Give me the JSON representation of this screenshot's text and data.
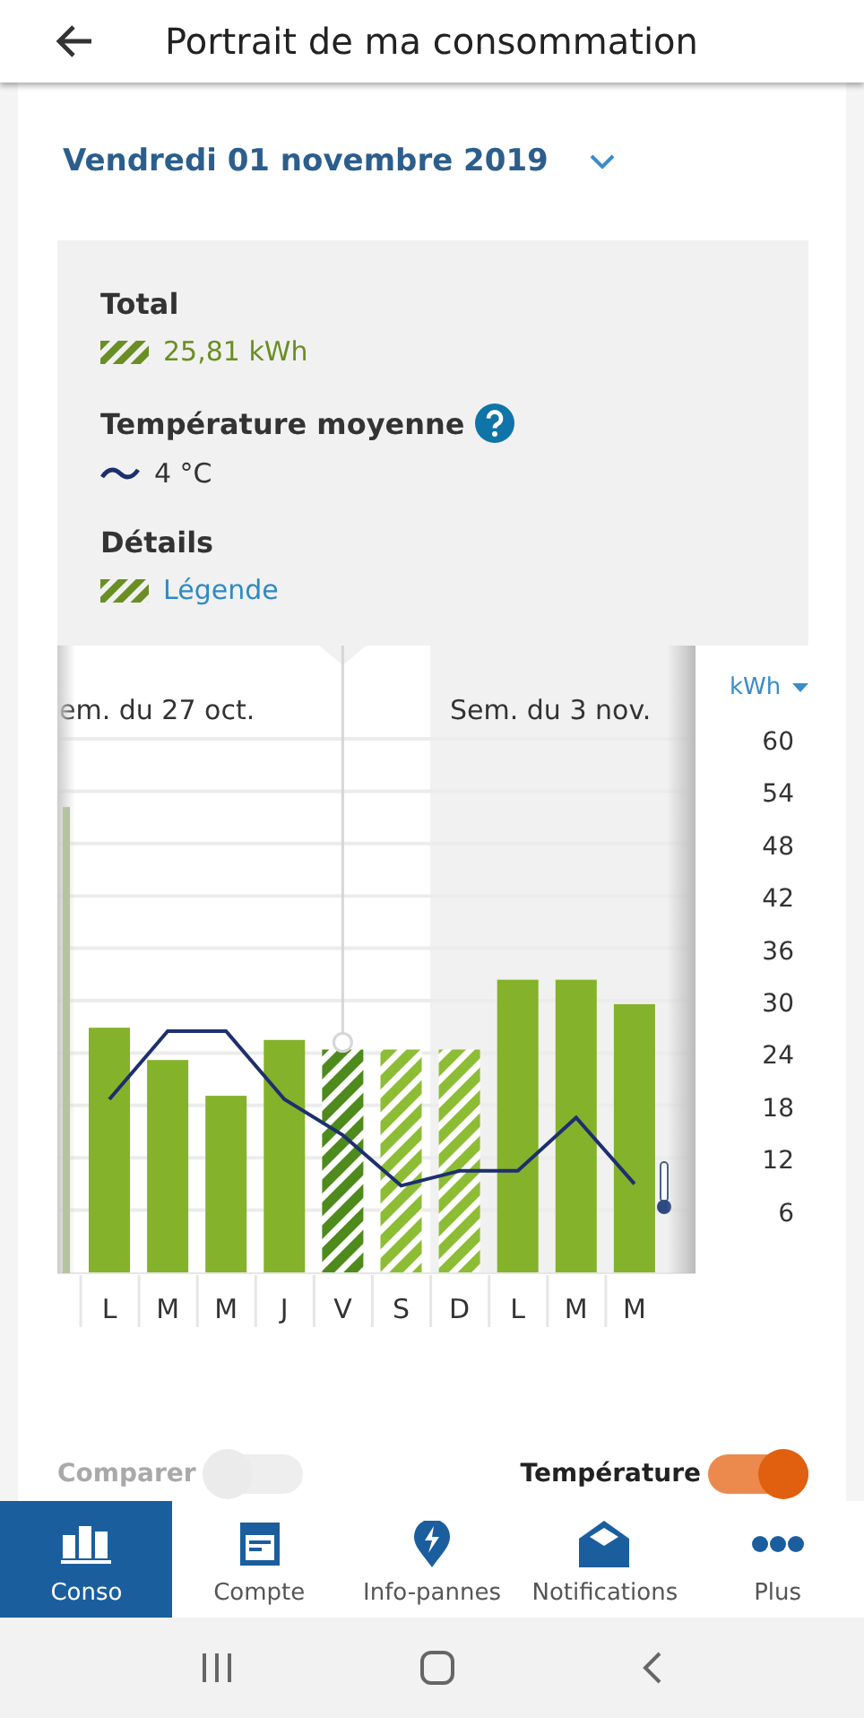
{
  "app_bar": {
    "title": "Portrait de ma consommation"
  },
  "date_selector": {
    "label": "Vendredi 01 novembre 2019"
  },
  "summary": {
    "total_label": "Total",
    "total_value": "25,81 kWh",
    "temperature_label": "Température moyenne",
    "temperature_value": "4 °C",
    "details_label": "Détails",
    "legend_link": "Légende"
  },
  "chart": {
    "weeks": [
      "em. du 27 oct.",
      "Sem. du 3 nov."
    ],
    "bar_states": [
      {
        "selected": false,
        "estimated": false
      },
      {
        "selected": false,
        "estimated": false
      },
      {
        "selected": false,
        "estimated": false
      },
      {
        "selected": false,
        "estimated": false
      },
      {
        "selected": true,
        "estimated": true
      },
      {
        "selected": false,
        "estimated": true
      },
      {
        "selected": false,
        "estimated": true
      },
      {
        "selected": false,
        "estimated": false
      },
      {
        "selected": false,
        "estimated": false
      },
      {
        "selected": false,
        "estimated": false
      }
    ],
    "chart_data": {
      "type": "bar",
      "categories": [
        "L",
        "M",
        "M",
        "J",
        "V",
        "S",
        "D",
        "L",
        "M",
        "M"
      ],
      "series": [
        {
          "color": "#84b22a",
          "values": [
            26.9,
            23.2,
            19.1,
            25.5,
            24.4,
            24.4,
            24.4,
            32.4,
            32.4,
            29.6
          ]
        },
        {
          "type": "line",
          "color": "#1d2f6e",
          "values": [
            18.7,
            26.5,
            26.5,
            18.7,
            14.6,
            8.8,
            10.5,
            10.5,
            16.6,
            9.0
          ]
        }
      ],
      "ylabel": "kWh",
      "grid": true,
      "ylim": [
        0,
        60
      ],
      "yticks": [
        6,
        12,
        18,
        24,
        30,
        36,
        42,
        48,
        54,
        60
      ]
    }
  },
  "toggles": [
    {
      "label": "Comparer",
      "on": false,
      "disabled": true
    },
    {
      "label": "Température",
      "on": true,
      "disabled": false
    }
  ],
  "bottom_nav": [
    {
      "label": "Conso",
      "selected": true
    },
    {
      "label": "Compte",
      "selected": false
    },
    {
      "label": "Info-pannes",
      "selected": false
    },
    {
      "label": "Notifications",
      "selected": false
    },
    {
      "label": "Plus",
      "selected": false
    }
  ]
}
